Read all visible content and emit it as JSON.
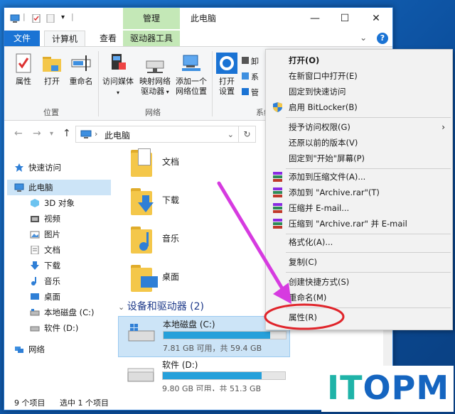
{
  "window": {
    "title": "此电脑",
    "ribbon_context_header": "管理",
    "controls": {
      "minimize": "—",
      "maximize": "☐",
      "close": "✕"
    }
  },
  "tabs": [
    {
      "label": "文件"
    },
    {
      "label": "计算机"
    },
    {
      "label": "查看"
    },
    {
      "label": "驱动器工具"
    }
  ],
  "help": {
    "chevron": "⌄",
    "icon": "?"
  },
  "ribbon": {
    "location_group": {
      "label": "位置",
      "buttons": [
        {
          "label": "属性"
        },
        {
          "label": "打开"
        },
        {
          "label": "重命名"
        }
      ]
    },
    "network_group": {
      "label": "网络",
      "buttons": [
        {
          "label_line1": "访问媒体",
          "label_line2": ""
        },
        {
          "label_line1": "映射网络",
          "label_line2": "驱动器"
        },
        {
          "label_line1": "添加一个",
          "label_line2": "网络位置"
        }
      ]
    },
    "system_group": {
      "label": "系统",
      "open_button": {
        "label_line1": "打开",
        "label_line2": "设置"
      },
      "small_items": [
        "卸",
        "系",
        "管"
      ]
    }
  },
  "address": {
    "path": "此电脑",
    "separator": "›"
  },
  "nav_pane": [
    {
      "label": "快速访问",
      "icon": "star-icon"
    },
    {
      "label": "此电脑",
      "icon": "computer-icon",
      "selected": true
    },
    {
      "label": "3D 对象",
      "icon": "cube-icon"
    },
    {
      "label": "视频",
      "icon": "video-icon"
    },
    {
      "label": "图片",
      "icon": "picture-icon"
    },
    {
      "label": "文档",
      "icon": "document-icon"
    },
    {
      "label": "下载",
      "icon": "download-icon"
    },
    {
      "label": "音乐",
      "icon": "music-icon"
    },
    {
      "label": "桌面",
      "icon": "desktop-icon"
    },
    {
      "label": "本地磁盘 (C:)",
      "icon": "drive-icon"
    },
    {
      "label": "软件 (D:)",
      "icon": "drive-icon"
    },
    {
      "label": "网络",
      "icon": "network-icon"
    }
  ],
  "folders": [
    {
      "label": "文档"
    },
    {
      "label": "下载"
    },
    {
      "label": "音乐"
    },
    {
      "label": "桌面"
    }
  ],
  "devices_header": "设备和驱动器 (2)",
  "drives": [
    {
      "name": "本地磁盘 (C:)",
      "info": "7.81 GB 可用，共 59.4 GB",
      "used_fraction": 0.87,
      "selected": true
    },
    {
      "name": "软件 (D:)",
      "info": "9.80 GB 可用，共 51.3 GB",
      "used_fraction": 0.81,
      "selected": false
    }
  ],
  "status": {
    "count": "9 个项目",
    "selected": "选中 1 个项目"
  },
  "context_menu": [
    {
      "label": "打开(O)",
      "bold": true
    },
    {
      "label": "在新窗口中打开(E)"
    },
    {
      "label": "固定到快速访问"
    },
    {
      "label": "启用 BitLocker(B)",
      "icon": "shield-icon"
    },
    {
      "label": "授予访问权限(G)",
      "submenu": true
    },
    {
      "label": "还原以前的版本(V)"
    },
    {
      "label": "固定到\"开始\"屏幕(P)"
    },
    {
      "label": "添加到压缩文件(A)...",
      "icon": "winrar-icon"
    },
    {
      "label": "添加到 \"Archive.rar\"(T)",
      "icon": "winrar-icon"
    },
    {
      "label": "压缩并 E-mail...",
      "icon": "winrar-icon"
    },
    {
      "label": "压缩到 \"Archive.rar\" 并 E-mail",
      "icon": "winrar-icon"
    },
    {
      "label": "格式化(A)..."
    },
    {
      "label": "复制(C)"
    },
    {
      "label": "创建快捷方式(S)"
    },
    {
      "label": "重命名(M)"
    },
    {
      "label": "属性(R)"
    }
  ],
  "submenu_arrow": "›",
  "watermark": {
    "text_part1": "IT",
    "text_part2": "OPM",
    "color1": "#1fb3a8",
    "color2": "#1565c0"
  },
  "colors": {
    "accent": "#1a73d4",
    "highlight_arrow": "#d63be0",
    "circle": "#e0242a",
    "selection": "#cce4f7",
    "drive_fill": "#26a0da"
  }
}
